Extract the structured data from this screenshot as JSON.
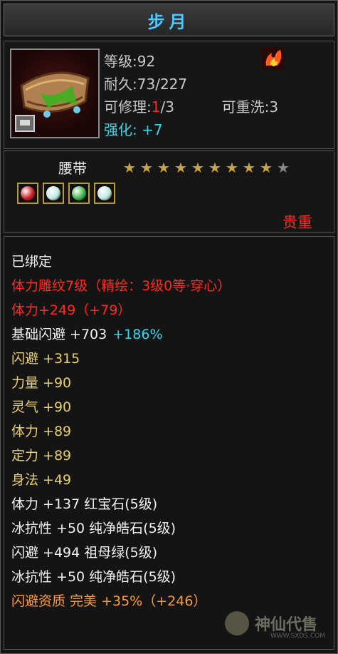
{
  "title": "步月",
  "header": {
    "level_label": "等级:",
    "level_value": "92",
    "durability_label": "耐久:",
    "durability_value": "73/227",
    "repair_label": "可修理:",
    "repair_current": "1",
    "repair_total": "/3",
    "rewash_label": "可重洗:",
    "rewash_value": "3",
    "enhance_label": "强化:",
    "enhance_value": "+7"
  },
  "item_icon": "belt-icon",
  "type_label": "腰带",
  "stars": {
    "filled": 9,
    "total": 10
  },
  "gems": [
    {
      "name": "ruby-gem-icon",
      "color": "#d0202a"
    },
    {
      "name": "pearl-gem-icon",
      "color": "#bfe8e0"
    },
    {
      "name": "emerald-gem-icon",
      "color": "#3fb84a"
    },
    {
      "name": "pearl-gem-icon",
      "color": "#bfe8e0"
    }
  ],
  "rarity": "贵重",
  "attributes": [
    {
      "parts": [
        {
          "t": "已绑定",
          "c": "white"
        }
      ]
    },
    {
      "parts": [
        {
          "t": "体力雕纹7级（精绘：3级0等·穿心）",
          "c": "red"
        }
      ]
    },
    {
      "parts": [
        {
          "t": "体力+249（+79）",
          "c": "red"
        }
      ]
    },
    {
      "parts": [
        {
          "t": "基础闪避 +703 ",
          "c": "white"
        },
        {
          "t": "+186%",
          "c": "cyan"
        }
      ]
    },
    {
      "parts": [
        {
          "t": "闪避 +315",
          "c": "gold"
        }
      ]
    },
    {
      "parts": [
        {
          "t": "力量 +90",
          "c": "gold"
        }
      ]
    },
    {
      "parts": [
        {
          "t": "灵气 +90",
          "c": "gold"
        }
      ]
    },
    {
      "parts": [
        {
          "t": "体力 +89",
          "c": "gold"
        }
      ]
    },
    {
      "parts": [
        {
          "t": "定力 +89",
          "c": "gold"
        }
      ]
    },
    {
      "parts": [
        {
          "t": "身法 +49",
          "c": "gold"
        }
      ]
    },
    {
      "parts": [
        {
          "t": "体力 +137 红宝石(5级)",
          "c": "white"
        }
      ]
    },
    {
      "parts": [
        {
          "t": "冰抗性 +50 纯净皓石(5级)",
          "c": "white"
        }
      ]
    },
    {
      "parts": [
        {
          "t": "闪避 +494 祖母绿(5级)",
          "c": "white"
        }
      ]
    },
    {
      "parts": [
        {
          "t": "冰抗性 +50 纯净皓石(5级)",
          "c": "white"
        }
      ]
    },
    {
      "parts": [
        {
          "t": "闪避资质  完美 +35%（+246）",
          "c": "orange"
        }
      ]
    }
  ],
  "watermark": {
    "text": "神仙代售",
    "url": "WWW.SXDS.COM"
  },
  "colors": {
    "title": "#4fc8ff",
    "cyan": "#35d6e6",
    "red": "#ff2a1f",
    "gold": "#e8cf6b",
    "orange": "#ff9a2e",
    "star": "#c9a445"
  }
}
